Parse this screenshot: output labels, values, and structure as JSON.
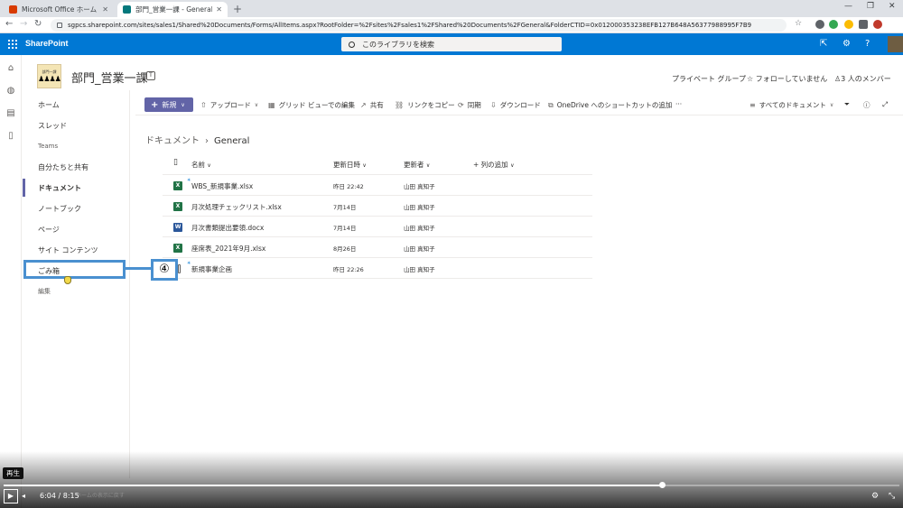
{
  "browser": {
    "tabs": [
      {
        "label": "Microsoft Office ホーム",
        "active": false
      },
      {
        "label": "部門_営業一課 - General - すべて",
        "active": true
      }
    ],
    "new_tab": "+",
    "url": "sgpcs.sharepoint.com/sites/sales1/Shared%20Documents/Forms/AllItems.aspx?RootFolder=%2Fsites%2Fsales1%2FShared%20Documents%2FGeneral&FolderCTID=0x012000353238EFB127B648A56377988995F7B9",
    "window_controls": [
      "—",
      "❐",
      "✕"
    ],
    "avatar_color": "#c0392b"
  },
  "suite": {
    "brand": "SharePoint",
    "search_placeholder": "このライブラリを検索",
    "accent": "#0078d4"
  },
  "site": {
    "title": "部門_営業一課",
    "logo_text": "部門一課",
    "logo_figures": "🯅🯅🯅🯅",
    "group_type": "プライベート グループ",
    "follow": "フォローしていません",
    "members": "3 人のメンバー"
  },
  "nav": {
    "items": [
      {
        "label": "ホーム"
      },
      {
        "label": "スレッド"
      },
      {
        "label": "Teams"
      },
      {
        "label": "自分たちと共有"
      },
      {
        "label": "ドキュメント"
      },
      {
        "label": "ノートブック"
      },
      {
        "label": "ページ"
      },
      {
        "label": "サイト コンテンツ"
      },
      {
        "label": "ごみ箱"
      },
      {
        "label": "編集"
      }
    ],
    "selected_index": 4
  },
  "commands": {
    "new": "新規",
    "upload": "アップロード",
    "grid": "グリッド ビューでの編集",
    "share": "共有",
    "copylink": "リンクをコピー",
    "sync": "同期",
    "download": "ダウンロード",
    "onedrive": "OneDrive へのショートカットの追加",
    "more": "···",
    "view": "すべてのドキュメント"
  },
  "breadcrumb": {
    "root": "ドキュメント",
    "current": "General"
  },
  "table": {
    "headers": {
      "name": "名前",
      "modified": "更新日時",
      "modified_by": "更新者",
      "add_column": "列の追加"
    },
    "rows": [
      {
        "type": "xlsx",
        "name": "WBS_新規事業.xlsx",
        "modified": "昨日 22:42",
        "by": "山田 真知子",
        "new": true
      },
      {
        "type": "xlsx",
        "name": "月次処理チェックリスト.xlsx",
        "modified": "7月14日",
        "by": "山田 真知子",
        "new": false
      },
      {
        "type": "docx",
        "name": "月次書類提出要領.docx",
        "modified": "7月14日",
        "by": "山田 真知子",
        "new": false
      },
      {
        "type": "xlsx",
        "name": "座席表_2021年9月.xlsx",
        "modified": "8月26日",
        "by": "山田 真知子",
        "new": false
      },
      {
        "type": "folder",
        "name": "新規事業企画",
        "modified": "昨日 22:26",
        "by": "山田 真知子",
        "new": true
      }
    ],
    "type_colors": {
      "xlsx": "#217346",
      "docx": "#2b579a",
      "folder": "#605e5c"
    },
    "type_letters": {
      "xlsx": "X",
      "docx": "W",
      "folder": ""
    }
  },
  "annotation": {
    "step": "④"
  },
  "video": {
    "tooltip": "再生",
    "current_time": "6:04",
    "separator": "/",
    "duration": "8:15",
    "caption_ghost": "ホームの表示に戻す",
    "progress": 0.735
  }
}
